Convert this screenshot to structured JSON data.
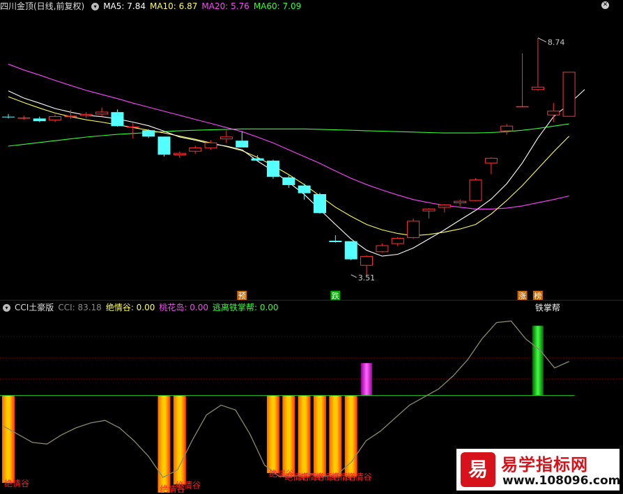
{
  "header_top": {
    "stock": "四川金顶(日线,前复权)",
    "items": [
      {
        "label": "MA5: 7.84",
        "color": "#ffffff"
      },
      {
        "label": "MA10: 6.87",
        "color": "#ffff55"
      },
      {
        "label": "MA20: 5.76",
        "color": "#ff44ff"
      },
      {
        "label": "MA60: 7.09",
        "color": "#33ff33"
      }
    ],
    "close_icon": "close-icon"
  },
  "header_bottom": {
    "title": "CCI土豪版",
    "items": [
      {
        "label": "CCI: 83.18",
        "color": "#888888"
      },
      {
        "label": "绝情谷: 0.00",
        "color": "#ffff55"
      },
      {
        "label": "桃花岛: 0.00",
        "color": "#ff44ff"
      },
      {
        "label": "逃离铁掌帮: 0.00",
        "color": "#33ff33"
      }
    ]
  },
  "watermark": {
    "logo_char": "易",
    "title": "易学指标网",
    "url": "www.108096.com"
  },
  "chart_data": [
    {
      "type": "candlestick",
      "title": "四川金顶(日线,前复权)",
      "colors": {
        "up": "#ff3333",
        "down": "#54ffff",
        "ma5": "#ffffff",
        "ma10": "#ffff55",
        "ma20": "#ff44ff",
        "ma60": "#33ff33"
      },
      "ylim": [
        3.0,
        9.3
      ],
      "candles": [
        {
          "o": 7.0,
          "h": 7.06,
          "l": 6.96,
          "c": 6.99
        },
        {
          "o": 6.98,
          "h": 7.02,
          "l": 6.93,
          "c": 6.98
        },
        {
          "o": 6.96,
          "h": 7.0,
          "l": 6.88,
          "c": 6.9
        },
        {
          "o": 6.92,
          "h": 7.05,
          "l": 6.88,
          "c": 7.01
        },
        {
          "o": 6.99,
          "h": 7.15,
          "l": 6.95,
          "c": 7.02
        },
        {
          "o": 7.02,
          "h": 7.1,
          "l": 6.97,
          "c": 7.06
        },
        {
          "o": 7.05,
          "h": 7.2,
          "l": 7.0,
          "c": 7.11
        },
        {
          "o": 7.1,
          "h": 7.16,
          "l": 6.78,
          "c": 6.79
        },
        {
          "o": 6.78,
          "h": 6.86,
          "l": 6.52,
          "c": 6.78
        },
        {
          "o": 6.7,
          "h": 6.72,
          "l": 6.53,
          "c": 6.56
        },
        {
          "o": 6.56,
          "h": 6.56,
          "l": 6.12,
          "c": 6.16
        },
        {
          "o": 6.15,
          "h": 6.23,
          "l": 6.09,
          "c": 6.2
        },
        {
          "o": 6.23,
          "h": 6.36,
          "l": 6.18,
          "c": 6.32
        },
        {
          "o": 6.3,
          "h": 6.48,
          "l": 6.27,
          "c": 6.43
        },
        {
          "o": 6.5,
          "h": 6.7,
          "l": 6.42,
          "c": 6.56
        },
        {
          "o": 6.47,
          "h": 6.68,
          "l": 6.32,
          "c": 6.32
        },
        {
          "o": 6.08,
          "h": 6.15,
          "l": 6.02,
          "c": 6.03
        },
        {
          "o": 6.03,
          "h": 6.05,
          "l": 5.63,
          "c": 5.67
        },
        {
          "o": 5.66,
          "h": 5.7,
          "l": 5.43,
          "c": 5.49
        },
        {
          "o": 5.48,
          "h": 5.52,
          "l": 5.17,
          "c": 5.31
        },
        {
          "o": 5.29,
          "h": 5.32,
          "l": 4.86,
          "c": 4.87
        },
        {
          "o": 4.26,
          "h": 4.38,
          "l": 4.22,
          "c": 4.23
        },
        {
          "o": 4.25,
          "h": 4.25,
          "l": 3.83,
          "c": 3.85
        },
        {
          "o": 3.71,
          "h": 3.94,
          "l": 3.51,
          "c": 3.92
        },
        {
          "o": 4.01,
          "h": 4.2,
          "l": 4.0,
          "c": 4.16
        },
        {
          "o": 4.19,
          "h": 4.34,
          "l": 4.15,
          "c": 4.32
        },
        {
          "o": 4.32,
          "h": 4.75,
          "l": 4.3,
          "c": 4.7
        },
        {
          "o": 4.91,
          "h": 4.98,
          "l": 4.75,
          "c": 4.97
        },
        {
          "o": 4.99,
          "h": 5.07,
          "l": 4.89,
          "c": 5.06
        },
        {
          "o": 5.09,
          "h": 5.17,
          "l": 5.03,
          "c": 5.14
        },
        {
          "o": 5.14,
          "h": 5.64,
          "l": 5.13,
          "c": 5.61
        },
        {
          "o": 5.97,
          "h": 6.1,
          "l": 5.73,
          "c": 6.09
        },
        {
          "o": 6.68,
          "h": 6.84,
          "l": 6.6,
          "c": 6.8
        },
        {
          "o": 7.23,
          "h": 8.4,
          "l": 7.23,
          "c": 7.23
        },
        {
          "o": 7.59,
          "h": 8.74,
          "l": 7.57,
          "c": 7.66
        },
        {
          "o": 7.03,
          "h": 7.3,
          "l": 6.88,
          "c": 7.13
        },
        {
          "o": 7.0,
          "h": 7.99,
          "l": 7.0,
          "c": 7.99
        }
      ],
      "ma5": [
        7.57,
        7.41,
        7.3,
        7.18,
        7.1,
        7.03,
        7.0,
        6.95,
        6.88,
        6.8,
        6.68,
        6.55,
        6.48,
        6.4,
        6.35,
        6.27,
        6.02,
        5.8,
        5.55,
        5.28,
        4.95,
        4.62,
        4.3,
        4.05,
        3.92,
        3.96,
        4.1,
        4.3,
        4.5,
        4.72,
        4.93,
        5.18,
        5.52,
        5.98,
        6.53,
        7.0,
        7.28,
        7.6
      ],
      "ma10": [
        7.44,
        7.31,
        7.19,
        7.08,
        7.0,
        6.93,
        6.88,
        6.82,
        6.76,
        6.7,
        6.64,
        6.57,
        6.5,
        6.42,
        6.34,
        6.25,
        6.1,
        5.92,
        5.72,
        5.5,
        5.25,
        5.0,
        4.8,
        4.62,
        4.5,
        4.42,
        4.37,
        4.4,
        4.45,
        4.52,
        4.62,
        4.85,
        5.15,
        5.48,
        5.85,
        6.22,
        6.57
      ],
      "ma20": [
        8.16,
        8.03,
        7.92,
        7.8,
        7.69,
        7.58,
        7.49,
        7.4,
        7.3,
        7.21,
        7.12,
        7.03,
        6.94,
        6.85,
        6.76,
        6.67,
        6.55,
        6.42,
        6.27,
        6.12,
        5.97,
        5.8,
        5.64,
        5.5,
        5.38,
        5.27,
        5.17,
        5.1,
        5.04,
        5.0,
        4.96,
        4.96,
        4.98,
        5.03,
        5.1,
        5.17,
        5.25
      ],
      "ma60": [
        6.35,
        6.39,
        6.43,
        6.47,
        6.51,
        6.55,
        6.58,
        6.61,
        6.63,
        6.65,
        6.67,
        6.69,
        6.7,
        6.71,
        6.72,
        6.73,
        6.73,
        6.73,
        6.73,
        6.73,
        6.72,
        6.71,
        6.7,
        6.69,
        6.68,
        6.67,
        6.66,
        6.65,
        6.64,
        6.64,
        6.64,
        6.65,
        6.67,
        6.7,
        6.74,
        6.79,
        6.84
      ],
      "annotations": [
        {
          "text": "8.74",
          "index": 34,
          "value": 8.74
        },
        {
          "text": "3.51",
          "index": 22,
          "value": 3.51
        }
      ],
      "signals": [
        {
          "text": "预",
          "index": 15,
          "bg": "#cc6600",
          "color": "#ffffff"
        },
        {
          "text": "跌",
          "index": 21,
          "bg": "#00aa00",
          "color": "#ffffff"
        },
        {
          "text": "涨",
          "index": 33,
          "bg": "#cc6600",
          "color": "#ffffff"
        },
        {
          "text": "榜",
          "index": 34,
          "bg": "#cc6600",
          "color": "#ffffff"
        }
      ]
    },
    {
      "type": "bar-line",
      "title": "CCI土豪版",
      "ylim": [
        -300,
        250
      ],
      "zero_line_color": "#22cc22",
      "cci": [
        -95,
        -120,
        -145,
        -150,
        -122,
        -100,
        -85,
        -77,
        -100,
        -140,
        -188,
        -253,
        -230,
        -140,
        -60,
        -30,
        -45,
        -120,
        -215,
        -250,
        -250,
        -240,
        -250,
        -245,
        -205,
        -140,
        -110,
        -70,
        -30,
        -5,
        20,
        60,
        110,
        175,
        225,
        230,
        175,
        140,
        85,
        105
      ],
      "juqinggu": [
        {
          "index": 0,
          "depth": -270,
          "label": "绝情谷"
        },
        {
          "index": 10,
          "depth": -300,
          "label": "绝情谷"
        },
        {
          "index": 11,
          "depth": -275,
          "label": "绝情谷"
        },
        {
          "index": 17,
          "depth": -240,
          "label": "绝情谷"
        },
        {
          "index": 18,
          "depth": -250,
          "label": "绝情谷"
        },
        {
          "index": 19,
          "depth": -250,
          "label": "绝情谷"
        },
        {
          "index": 20,
          "depth": -250,
          "label": "绝情谷"
        },
        {
          "index": 21,
          "depth": -250,
          "label": "绝情谷"
        },
        {
          "index": 22,
          "depth": -250,
          "label": "绝情谷"
        }
      ],
      "taohuadao": [
        {
          "index": 23,
          "value": 100
        }
      ],
      "tiezhangbang": [
        {
          "index": 34,
          "value": 215,
          "label": "铁掌帮"
        }
      ]
    }
  ]
}
